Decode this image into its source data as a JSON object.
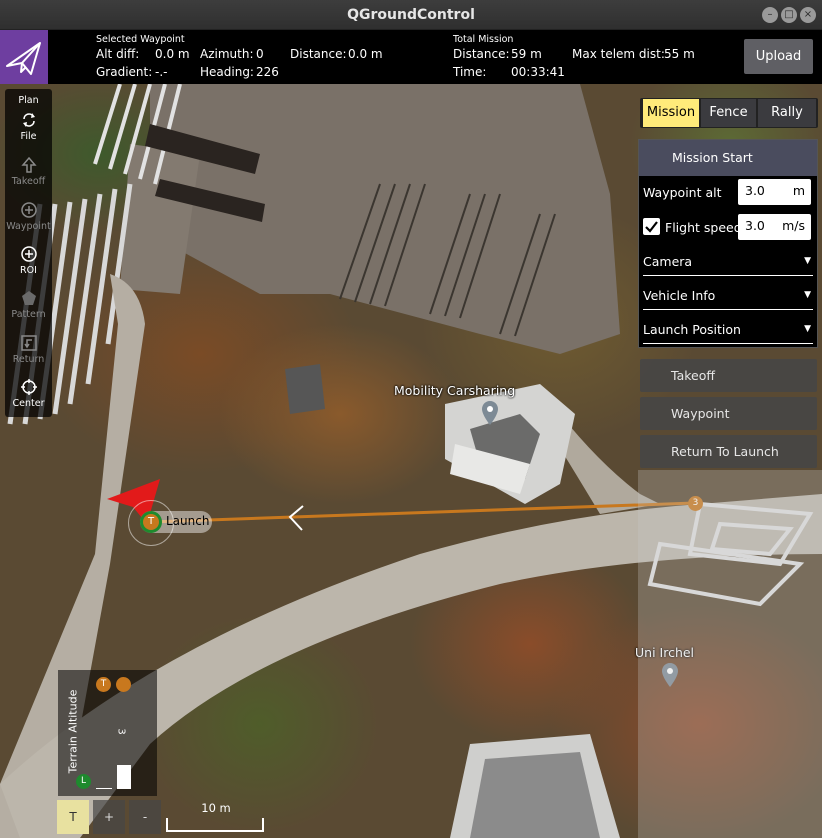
{
  "window": {
    "title": "QGroundControl",
    "controls": [
      "–",
      "□",
      "×"
    ]
  },
  "toolbar": {
    "selected_waypoint_header": "Selected Waypoint",
    "alt_diff_label": "Alt diff:",
    "alt_diff_value": "0.0 m",
    "azimuth_label": "Azimuth:",
    "azimuth_value": "0",
    "distance_label": "Distance:",
    "distance_value": "0.0 m",
    "gradient_label": "Gradient:",
    "gradient_value": "-.-",
    "heading_label": "Heading:",
    "heading_value": "226",
    "total_mission_header": "Total Mission",
    "total_distance_label": "Distance:",
    "total_distance_value": "59 m",
    "time_label": "Time:",
    "time_value": "00:33:41",
    "max_telem_label": "Max telem dist:",
    "max_telem_value": "55 m",
    "upload_label": "Upload"
  },
  "tools": [
    {
      "label": "Plan",
      "icon": "plan-icon",
      "enabled": true
    },
    {
      "label": "File",
      "icon": "sync-icon",
      "enabled": true
    },
    {
      "label": "Takeoff",
      "icon": "takeoff-icon",
      "enabled": false
    },
    {
      "label": "Waypoint",
      "icon": "waypoint-add-icon",
      "enabled": false
    },
    {
      "label": "ROI",
      "icon": "roi-add-icon",
      "enabled": true
    },
    {
      "label": "Pattern",
      "icon": "pattern-icon",
      "enabled": false
    },
    {
      "label": "Return",
      "icon": "return-icon",
      "enabled": false
    },
    {
      "label": "Center",
      "icon": "center-icon",
      "enabled": true
    }
  ],
  "tabs": [
    {
      "label": "Mission",
      "active": true
    },
    {
      "label": "Fence",
      "active": false
    },
    {
      "label": "Rally",
      "active": false
    }
  ],
  "mission_start": {
    "header": "Mission Start",
    "waypoint_alt_label": "Waypoint alt",
    "waypoint_alt_value": "3.0",
    "waypoint_alt_unit": "m",
    "flight_speed_label": "Flight speed",
    "flight_speed_checked": true,
    "flight_speed_value": "3.0",
    "flight_speed_unit": "m/s",
    "sections": [
      "Camera",
      "Vehicle Info",
      "Launch Position"
    ]
  },
  "mission_items": [
    "Takeoff",
    "Waypoint",
    "Return To Launch"
  ],
  "map": {
    "launch_badge": "T",
    "launch_label": "Launch",
    "waypoint_number": "3",
    "poi_1": "Mobility Carsharing",
    "poi_2": "Uni Irchel",
    "path_color": "#c8781e",
    "launch_color": "#1e8a2e",
    "vehicle_color": "#e21a1a"
  },
  "terrain": {
    "title": "Terrain Altitude",
    "marker_t": "T",
    "marker_l": "L",
    "marker_3": "3"
  },
  "bottom_buttons": [
    "T",
    "+",
    "-"
  ],
  "scale_label": "10 m",
  "colors": {
    "plan_accent": "#6e3ea0",
    "tab_active": "#ffeb7a"
  }
}
